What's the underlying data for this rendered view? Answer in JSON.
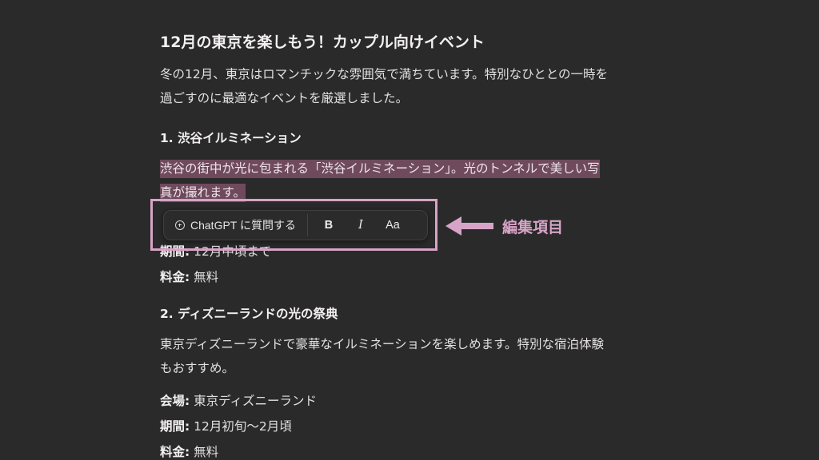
{
  "article": {
    "title": "12月の東京を楽しもう！カップル向けイベント",
    "intro": {
      "line1": "冬の12月、東京はロマンチックな雰囲気で満ちています。特別なひととの一時を",
      "line2": "過ごすのに最適なイベントを厳選しました。"
    },
    "section1": {
      "heading": "1. 渋谷イルミネーション",
      "selected_line1": "渋谷の街中が光に包まれる「渋谷イルミネーション」。光のトンネルで美しい写",
      "selected_line2": "真が撮れます。",
      "period_label": "期間:",
      "period_value": "12月中頃まで",
      "fee_label": "料金:",
      "fee_value": "無料"
    },
    "section2": {
      "heading": "2. ディズニーランドの光の祭典",
      "desc_line1": "東京ディズニーランドで豪華なイルミネーションを楽しめます。特別な宿泊体験",
      "desc_line2": "もおすすめ。",
      "venue_label": "会場:",
      "venue_value": "東京ディズニーランド",
      "period_label": "期間:",
      "period_value": "12月初旬〜2月頃",
      "fee_label": "料金:",
      "fee_value": "無料"
    }
  },
  "toolbar": {
    "ask_icon": "plus-circle-icon",
    "ask_label": "ChatGPT に質問する",
    "bold_label": "B",
    "italic_label": "I",
    "font_label": "Aa"
  },
  "annotation": {
    "label": "編集項目",
    "color": "#d6a4c6"
  },
  "colors": {
    "background": "#2b2a2b",
    "selection": "#6e4a5c"
  }
}
